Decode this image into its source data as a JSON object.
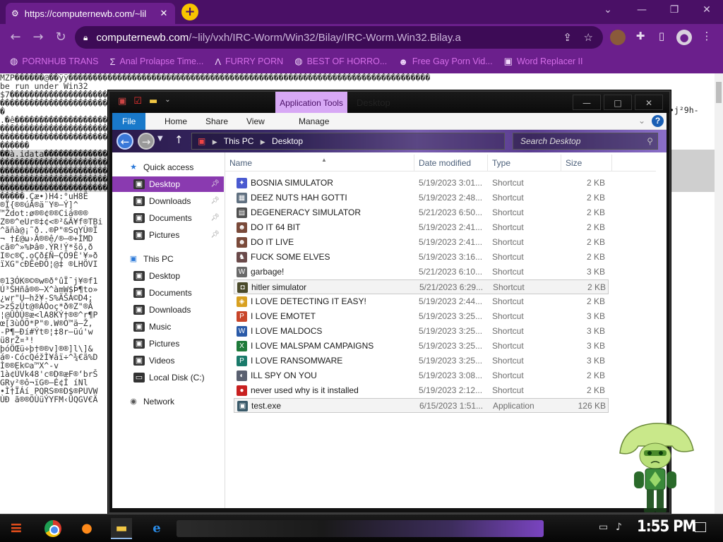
{
  "browser": {
    "tab_title": "https://computernewb.com/~lil",
    "tab_close": "✕",
    "new_tab": "+",
    "window_controls": [
      "—",
      "❐",
      "✕"
    ],
    "url_host": "computernewb.com",
    "url_path": "/~lily/vxh/IRC-Worm/Win32/Bilay/IRC-Worm.Win32.Bilay.a",
    "bookmarks": [
      {
        "icon": "globe-icon",
        "glyph": "◍",
        "label": "PORNHUB TRANS"
      },
      {
        "icon": "sigma-icon",
        "glyph": "Σ",
        "label": "Anal Prolapse Time..."
      },
      {
        "icon": "lambda-icon",
        "glyph": "Λ",
        "label": "FURRY PORN"
      },
      {
        "icon": "globe-icon",
        "glyph": "◍",
        "label": "BEST OF HORRO..."
      },
      {
        "icon": "dog-icon",
        "glyph": "☻",
        "label": "Free Gay Porn Vid..."
      },
      {
        "icon": "wr-icon",
        "glyph": "▣",
        "label": "Word Replacer II"
      }
    ]
  },
  "page": {
    "lines": [
      "MZP������@��ÿÿ��������������������������������������������������������������������������",
      "be run under Win32",
      "$7������������������������������������������������������������������������������������",
      "��������������������������������������������������������������������������������������",
      "�",
      ".�ê������������������������������������������������������������������������������������",
      "��������������������������������������������������������������������������������������",
      "�������������������������������������������������������������������������������������",
      "������",
      "��à.idata����������������������������������������������������������������������������",
      "�������������������������������������������������������������������������������������",
      "�������������������������������������������������������������������������������������",
      "�������������������������������������������������������������������������������������",
      "�������������������������������������������������������������������������������������",
      "�����.Çæ•)H4:°uH8Ë",
      "®Ï{®®úÂ®ä¨Y®–Ý]^",
      "™Ždot:ø®®¢®®Ciá®®®",
      "Z®®^eUr®‡¢<®²&Ä¥f®TBi",
      "^ãñà@¡˜ð..®P\"®SqYÙ®Ï",
      "¬ †£@ω›Ä®®ê/®–®+ÌMD",
      "cã®^»%Þâ®.ÝR!Ý*šõ,ð",
      "I®c®Ç.oÇð£Ñ–ÇÕ9È'¥»ð",
      "ïXG\"cÐÊeÐÔ¦@‡ ®LHÖVI",
      "",
      "®13ÓK®©®w®ð°ûÏ¯j¥®f1",
      "Ú³ŠHñâ®®–X^àmW$Þ¶to»",
      "¿wr\"U–hž¥-S%ÄŠÁ©D4;",
      ">zŠzÛt@®ÀÒoç*ð®Z\"®Â",
      "¦@ÛÒÙ®æ<lA8KÝ†®®^r¶P",
      "œ[3ùÔÕ*P\"®.W®Ò™ä–Ž,",
      "-P¶–Ðí#Ýt®¦‡8r–üú'w",
      "ü8rŽ¤³!",
      "þóÖŒü÷þ†®®v]®®]l\\]&",
      "á®·CócQéžÌ¥âï÷^¾€ã%D",
      "Ì®®Ek©a™X^-v",
      "1à¢ÙVk48'c®D®æF®‘brŠ",
      "GRy²®ô¬ïG®–É¢Í  íNl",
      "•Ì†ÏÁí PQRS®®D$®PUVW",
      "ÙÐ ã®®ÕÙüÝYFM‹ÜQGV€Ä"
    ],
    "dark_line_indexes": [
      9,
      10,
      11,
      12,
      13
    ],
    "right_snippet": "•j²9h-"
  },
  "explorer": {
    "context_tab": "Application Tools",
    "window_title": "Desktop",
    "window_controls": [
      "—",
      "□",
      "✕"
    ],
    "ribbon_tabs": [
      "File",
      "Home",
      "Share",
      "View",
      "Manage"
    ],
    "help": "?",
    "breadcrumb": [
      "This PC",
      "Desktop"
    ],
    "search_placeholder": "Search Desktop",
    "columns": [
      "Name",
      "Date modified",
      "Type",
      "Size"
    ],
    "nav": [
      {
        "label": "Quick access",
        "icon": "star-icon",
        "glyph": "★",
        "pinned": false,
        "level": 0
      },
      {
        "label": "Desktop",
        "icon": "desktop-icon",
        "glyph": "▣",
        "pinned": true,
        "level": 1,
        "selected": true
      },
      {
        "label": "Downloads",
        "icon": "downloads-icon",
        "glyph": "▣",
        "pinned": true,
        "level": 1
      },
      {
        "label": "Documents",
        "icon": "documents-icon",
        "glyph": "▣",
        "pinned": true,
        "level": 1
      },
      {
        "label": "Pictures",
        "icon": "pictures-icon",
        "glyph": "▣",
        "pinned": true,
        "level": 1
      },
      {
        "label": "This PC",
        "icon": "computer-icon",
        "glyph": "▣",
        "pinned": false,
        "level": 0
      },
      {
        "label": "Desktop",
        "icon": "desktop-icon",
        "glyph": "▣",
        "pinned": false,
        "level": 1
      },
      {
        "label": "Documents",
        "icon": "documents-icon",
        "glyph": "▣",
        "pinned": false,
        "level": 1
      },
      {
        "label": "Downloads",
        "icon": "downloads-icon",
        "glyph": "▣",
        "pinned": false,
        "level": 1
      },
      {
        "label": "Music",
        "icon": "music-icon",
        "glyph": "▣",
        "pinned": false,
        "level": 1
      },
      {
        "label": "Pictures",
        "icon": "pictures-icon",
        "glyph": "▣",
        "pinned": false,
        "level": 1
      },
      {
        "label": "Videos",
        "icon": "videos-icon",
        "glyph": "▣",
        "pinned": false,
        "level": 1
      },
      {
        "label": "Local Disk (C:)",
        "icon": "drive-icon",
        "glyph": "▭",
        "pinned": false,
        "level": 1
      },
      {
        "label": "Network",
        "icon": "network-icon",
        "glyph": "◉",
        "pinned": false,
        "level": 0
      }
    ],
    "files": [
      {
        "name": "BOSNIA SIMULATOR",
        "date": "5/19/2023 3:01...",
        "type": "Shortcut",
        "size": "2 KB",
        "icon": "game-shortcut-icon",
        "glyph": "✦",
        "color": "#4a5ad0"
      },
      {
        "name": "DEEZ NUTS HAH GOTTI",
        "date": "5/19/2023 2:48...",
        "type": "Shortcut",
        "size": "2 KB",
        "icon": "image-shortcut-icon",
        "glyph": "▦",
        "color": "#607080"
      },
      {
        "name": "DEGENERACY SIMULATOR",
        "date": "5/21/2023 6:50...",
        "type": "Shortcut",
        "size": "2 KB",
        "icon": "document-shortcut-icon",
        "glyph": "▤",
        "color": "#505050"
      },
      {
        "name": "DO IT 64 BIT",
        "date": "5/19/2023 2:41...",
        "type": "Shortcut",
        "size": "2 KB",
        "icon": "face-shortcut-icon",
        "glyph": "☻",
        "color": "#7a4a3a"
      },
      {
        "name": "DO IT LIVE",
        "date": "5/19/2023 2:41...",
        "type": "Shortcut",
        "size": "2 KB",
        "icon": "face-shortcut-icon",
        "glyph": "☻",
        "color": "#7a4a3a"
      },
      {
        "name": "FUCK SOME ELVES",
        "date": "5/19/2023 3:16...",
        "type": "Shortcut",
        "size": "2 KB",
        "icon": "elf-shortcut-icon",
        "glyph": "♞",
        "color": "#6a4a4a"
      },
      {
        "name": "garbage!",
        "date": "5/21/2023 6:10...",
        "type": "Shortcut",
        "size": "3 KB",
        "icon": "wikipedia-shortcut-icon",
        "glyph": "W",
        "color": "#6a6a6a"
      },
      {
        "name": "hitler simulator",
        "date": "5/21/2023 6:29...",
        "type": "Shortcut",
        "size": "2 KB",
        "icon": "exe-shortcut-icon",
        "glyph": "◘",
        "color": "#4a4a2a",
        "selected": true
      },
      {
        "name": "I LOVE DETECTING IT EASY!",
        "date": "5/19/2023 2:44...",
        "type": "Shortcut",
        "size": "2 KB",
        "icon": "app-shortcut-icon",
        "glyph": "◈",
        "color": "#d8a020"
      },
      {
        "name": "I LOVE EMOTET",
        "date": "5/19/2023 3:25...",
        "type": "Shortcut",
        "size": "3 KB",
        "icon": "powerpoint-shortcut-icon",
        "glyph": "P",
        "color": "#c8452a"
      },
      {
        "name": "I LOVE MALDOCS",
        "date": "5/19/2023 3:25...",
        "type": "Shortcut",
        "size": "3 KB",
        "icon": "word-shortcut-icon",
        "glyph": "W",
        "color": "#2a5aa8"
      },
      {
        "name": "I LOVE MALSPAM CAMPAIGNS",
        "date": "5/19/2023 3:25...",
        "type": "Shortcut",
        "size": "3 KB",
        "icon": "excel-shortcut-icon",
        "glyph": "X",
        "color": "#1f7a3a"
      },
      {
        "name": "I LOVE RANSOMWARE",
        "date": "5/19/2023 3:25...",
        "type": "Shortcut",
        "size": "3 KB",
        "icon": "publisher-shortcut-icon",
        "glyph": "P",
        "color": "#1a7a6a"
      },
      {
        "name": "ILL SPY ON YOU",
        "date": "5/19/2023 3:08...",
        "type": "Shortcut",
        "size": "2 KB",
        "icon": "camera-shortcut-icon",
        "glyph": "◐",
        "color": "#5a6070"
      },
      {
        "name": "never used why is it installed",
        "date": "5/19/2023 2:12...",
        "type": "Shortcut",
        "size": "2 KB",
        "icon": "app-shortcut-icon",
        "glyph": "●",
        "color": "#c82020"
      },
      {
        "name": "test.exe",
        "date": "6/15/2023 1:51...",
        "type": "Application",
        "size": "126 KB",
        "icon": "application-icon",
        "glyph": "▣",
        "color": "#3a5a6a",
        "selected": true
      }
    ]
  },
  "taskbar": {
    "clock": "1:55 PM",
    "apps": [
      "start-icon",
      "chrome-icon",
      "firefox-icon",
      "file-explorer-icon",
      "internet-explorer-icon"
    ]
  },
  "colors": {
    "chrome_purple": "#6b1f8c",
    "tab_strip": "#4a1066",
    "bookmark_text": "#d46de8",
    "nav_selected": "#8a3ab0",
    "context_tab": "#d7a8f5",
    "file_tab": "#1979ca"
  }
}
